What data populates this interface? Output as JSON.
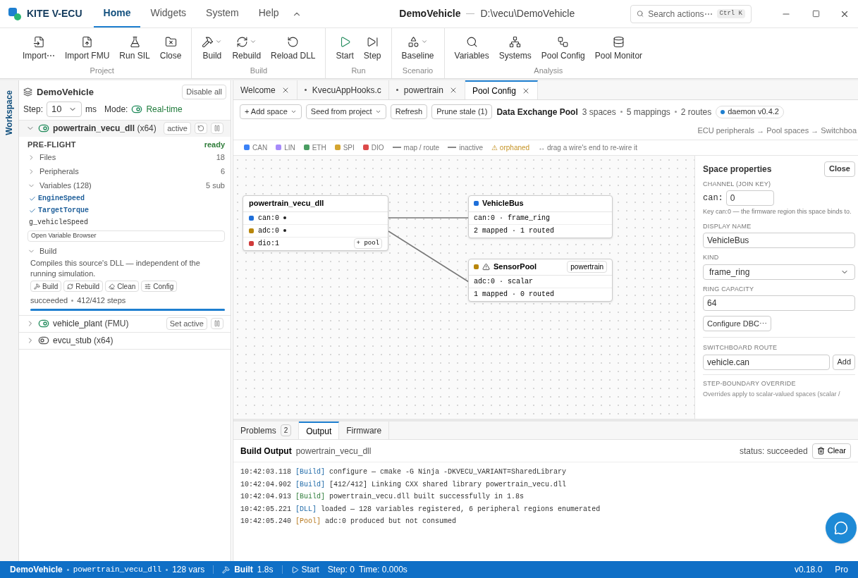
{
  "app": {
    "name": "KITE V-ECU",
    "menus": [
      {
        "label": "Home",
        "selected": true
      },
      {
        "label": "Widgets",
        "selected": false
      },
      {
        "label": "System",
        "selected": false
      },
      {
        "label": "Help",
        "selected": false
      }
    ],
    "project": "DemoVehicle",
    "path": "D:\\vecu\\DemoVehicle",
    "search": {
      "placeholder": "Search actions⋯",
      "shortcut": "Ctrl K"
    }
  },
  "ribbon": [
    {
      "label": "Project",
      "buttons": [
        {
          "label": "Import⋯",
          "dropdown": false
        },
        {
          "label": "Import FMU",
          "dropdown": false
        },
        {
          "label": "Run SIL",
          "dropdown": false
        },
        {
          "label": "Close",
          "dropdown": false
        }
      ]
    },
    {
      "label": "Build",
      "buttons": [
        {
          "label": "Build",
          "dropdown": true
        },
        {
          "label": "Rebuild",
          "dropdown": true
        },
        {
          "label": "Reload DLL",
          "dropdown": false
        }
      ]
    },
    {
      "label": "Run",
      "buttons": [
        {
          "label": "Start",
          "dropdown": false
        },
        {
          "label": "Step",
          "dropdown": false
        }
      ]
    },
    {
      "label": "Scenario",
      "buttons": [
        {
          "label": "Baseline",
          "dropdown": true
        }
      ]
    },
    {
      "label": "Analysis",
      "buttons": [
        {
          "label": "Variables",
          "dropdown": false
        },
        {
          "label": "Systems",
          "dropdown": false
        },
        {
          "label": "Pool Config",
          "dropdown": false
        },
        {
          "label": "Pool Monitor",
          "dropdown": false
        }
      ]
    }
  ],
  "sidebar": {
    "tab": "Workspace",
    "title": "DemoVehicle",
    "disable_all": "Disable all",
    "step_label": "Step:",
    "step_value": "10",
    "step_unit": "ms",
    "mode_label": "Mode:",
    "mode": "Real-time",
    "sources": [
      {
        "name": "powertrain_vecu_dll",
        "suffix": "(x64)",
        "expanded": true,
        "enabled": true,
        "badge": "active",
        "actions": true
      },
      {
        "name": "vehicle_plant",
        "suffix": "(FMU)",
        "expanded": false,
        "enabled": true,
        "badge": "Set active",
        "actions": false
      },
      {
        "name": "evcu_stub",
        "suffix": "(x64)",
        "expanded": false,
        "enabled": false,
        "actions": false
      }
    ],
    "preflight": {
      "label": "PRE-FLIGHT",
      "status": "ready",
      "sections": [
        {
          "label": "Files",
          "count": "18",
          "expanded": false
        },
        {
          "label": "Peripherals",
          "count": "6",
          "expanded": false
        },
        {
          "label": "Variables (128)",
          "count": "5 sub",
          "expanded": true
        }
      ],
      "variables": [
        {
          "name": "EngineSpeed",
          "checked": true
        },
        {
          "name": "TargetTorque",
          "checked": true
        },
        {
          "name": "g_vehicleSpeed",
          "checked": false
        }
      ],
      "browser_button": "Open Variable Browser"
    },
    "build": {
      "label": "Build",
      "expanded": true,
      "description": "Compiles this source's DLL — independent of the running simulation.",
      "buttons": [
        "Build",
        "Rebuild",
        "Clean",
        "Config"
      ],
      "status": "succeeded",
      "steps": "412/412 steps",
      "level": 1
    }
  },
  "tabs": [
    {
      "label": "Welcome",
      "modified": false,
      "closable": true,
      "selected": false
    },
    {
      "label": "KvecuAppHooks.c",
      "modified": true,
      "closable": false,
      "selected": false
    },
    {
      "label": "powertrain",
      "modified": true,
      "closable": true,
      "selected": false
    },
    {
      "label": "Pool Config",
      "modified": false,
      "closable": true,
      "selected": true
    }
  ],
  "pool": {
    "buttons": [
      {
        "label": "+ Add space",
        "dropdown": true
      },
      {
        "label": "Seed from project",
        "dropdown": true
      },
      {
        "label": "Refresh",
        "dropdown": false
      },
      {
        "label": "Prune stale (1)",
        "dropdown": false
      }
    ],
    "title": "Data Exchange Pool",
    "stats": [
      "3 spaces",
      "5 mappings",
      "2 routes"
    ],
    "daemon": "daemon v0.4.2",
    "flow": "ECU peripherals → Pool spaces → Switchboa",
    "legend": [
      {
        "label": "CAN",
        "kind": "dot",
        "color": "#3b82f6"
      },
      {
        "label": "LIN",
        "kind": "dot",
        "color": "#a78bfa"
      },
      {
        "label": "ETH",
        "kind": "dot",
        "color": "#4a9d62"
      },
      {
        "label": "SPI",
        "kind": "dot",
        "color": "#d4a531"
      },
      {
        "label": "DIO",
        "kind": "dot",
        "color": "#dc4a4a"
      },
      {
        "label": "map / route",
        "kind": "solid"
      },
      {
        "label": "inactive",
        "kind": "dashed"
      },
      {
        "label": "⚠ orphaned",
        "kind": "warning"
      },
      {
        "label": "↔ drag a wire's end to re-wire it",
        "kind": "hint"
      }
    ],
    "source_node": {
      "title": "powertrain_vecu_dll",
      "ports": [
        {
          "name": "can:0",
          "color": "#1e6fd9",
          "connected": true
        },
        {
          "name": "adc:0",
          "color": "#b8860b",
          "connected": true
        },
        {
          "name": "dio:1",
          "color": "#d03a3a",
          "connected": false,
          "action": "+ pool"
        }
      ]
    },
    "spaces": [
      {
        "name": "VehicleBus",
        "color": "#1e6fd9",
        "orphaned": false,
        "detail": "can:0 · frame_ring",
        "summary": "2 mapped · 1 routed"
      },
      {
        "name": "SensorPool",
        "color": "#b8860b",
        "orphaned": true,
        "tag": "powertrain",
        "detail": "adc:0 · scalar",
        "summary": "1 mapped · 0 routed"
      }
    ],
    "properties": {
      "title": "Space properties",
      "close": "Close",
      "channel_label": "CHANNEL (JOIN KEY)",
      "channel_prefix": "can:",
      "channel_value": "0",
      "channel_hint": "Key can:0 — the firmware region this space binds to.",
      "name_label": "DISPLAY NAME",
      "name_value": "VehicleBus",
      "kind_label": "KIND",
      "kind_value": "frame_ring",
      "capacity_label": "RING CAPACITY",
      "capacity_value": "64",
      "dbc_button": "Configure DBC⋯",
      "route_label": "SWITCHBOARD ROUTE",
      "route_value": "vehicle.can",
      "route_add": "Add",
      "override_label": "STEP-BOUNDARY OVERRIDE",
      "override_text": "Overrides apply to scalar-valued spaces (scalar /"
    }
  },
  "panel": {
    "tabs": [
      {
        "label": "Problems",
        "count": "2",
        "selected": false
      },
      {
        "label": "Output",
        "selected": true
      },
      {
        "label": "Firmware",
        "selected": false
      }
    ],
    "title": "Build Output",
    "source": "powertrain_vecu_dll",
    "status": "status: succeeded",
    "clear": "Clear",
    "log": [
      {
        "time": "10:42:03.118",
        "tag": "[Build]",
        "kind": "build",
        "text": "configure — cmake -G Ninja -DKVECU_VARIANT=SharedLibrary"
      },
      {
        "time": "10:42:04.902",
        "tag": "[Build]",
        "kind": "build",
        "text": "[412/412] Linking CXX shared library powertrain_vecu.dll"
      },
      {
        "time": "10:42:04.913",
        "tag": "[Build]",
        "kind": "success",
        "text": "powertrain_vecu.dll built successfully in 1.8s"
      },
      {
        "time": "10:42:05.221",
        "tag": "[DLL]",
        "kind": "build",
        "text": "loaded — 128 variables registered, 6 peripheral regions enumerated"
      },
      {
        "time": "10:42:05.240",
        "tag": "[Pool]",
        "kind": "warning",
        "text": "adc:0 produced but not consumed"
      }
    ]
  },
  "status_bar": {
    "project": "DemoVehicle",
    "source": "powertrain_vecu_dll",
    "vars": "128 vars",
    "built": "Built",
    "built_time": "1.8s",
    "start": "Start",
    "step": "Step: 0",
    "time": "Time: 0.000s",
    "version": "v0.18.0",
    "edition": "Pro"
  }
}
